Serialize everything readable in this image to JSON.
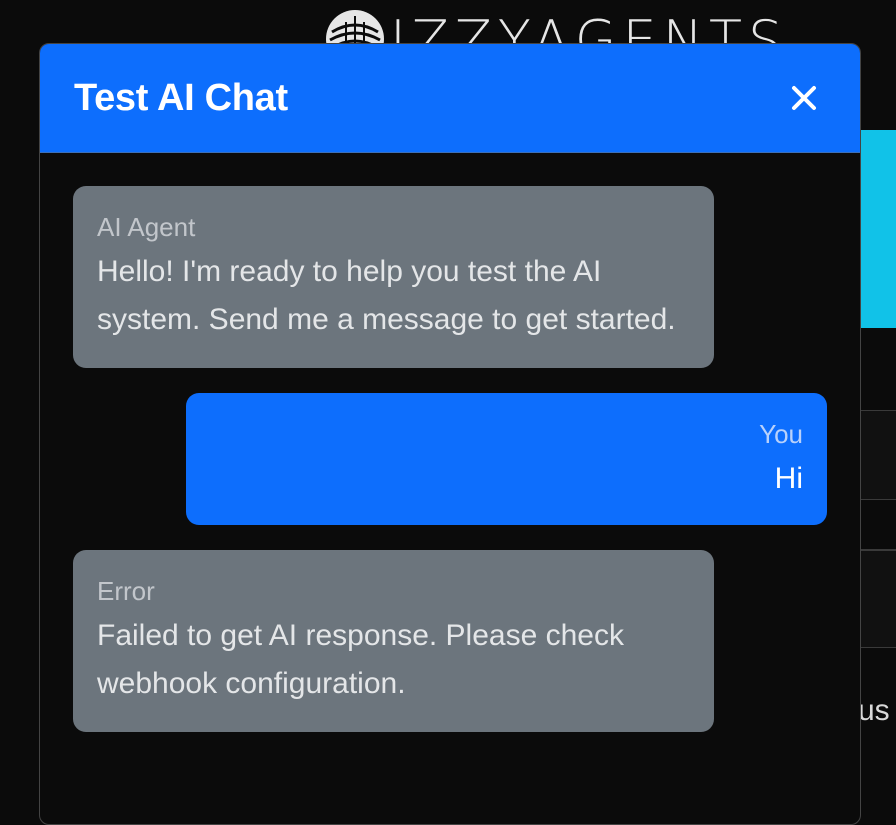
{
  "background": {
    "brand_name": "IZZYAGENTS",
    "peek_text": "us",
    "accent_cyan": "#11c2e8"
  },
  "modal": {
    "title": "Test AI Chat",
    "close_label": "×",
    "header_color": "#0d6efd"
  },
  "messages": [
    {
      "role": "ai",
      "sender": "AI Agent",
      "text": "Hello! I'm ready to help you test the AI system. Send me a message to get started."
    },
    {
      "role": "user",
      "sender": "You",
      "text": "Hi"
    },
    {
      "role": "error",
      "sender": "Error",
      "text": "Failed to get AI response. Please check webhook configuration."
    }
  ]
}
